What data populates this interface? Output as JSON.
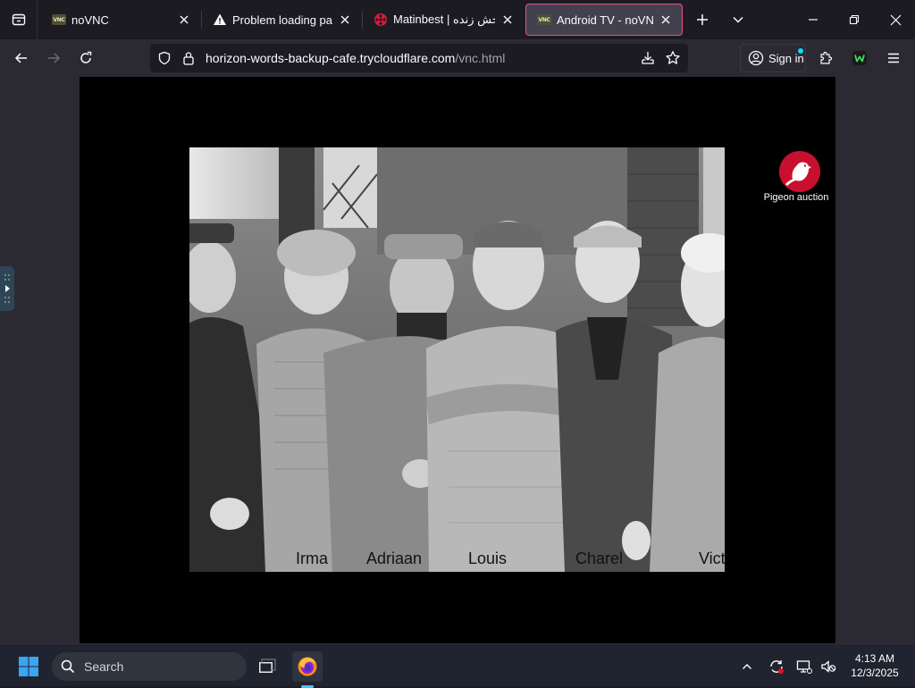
{
  "browser": {
    "tabs": [
      {
        "title": "noVNC",
        "favicon": "vnc-favicon",
        "active": false
      },
      {
        "title": "Problem loading page",
        "favicon": "warning-icon",
        "active": false
      },
      {
        "title": "Matinbest | پخش زنده",
        "favicon": "film-reel-favicon",
        "active": false
      },
      {
        "title": "Android TV - noVNC",
        "favicon": "vnc-favicon",
        "active": true
      }
    ],
    "favicon_text": "VNC",
    "url": {
      "host": "horizon-words-backup-cafe.trycloudflare.com",
      "path": "/vnc.html"
    },
    "sign_in_label": "Sign in",
    "accent_color": "#e64e8e"
  },
  "vnc": {
    "photo_names": [
      "Irma",
      "Adriaan",
      "Louis",
      "Charel",
      "Vict"
    ],
    "logo_caption": "Pigeon auction",
    "logo_color": "#c8102e"
  },
  "taskbar": {
    "search_placeholder": "Search",
    "time": "4:13 AM",
    "date": "12/3/2025"
  }
}
